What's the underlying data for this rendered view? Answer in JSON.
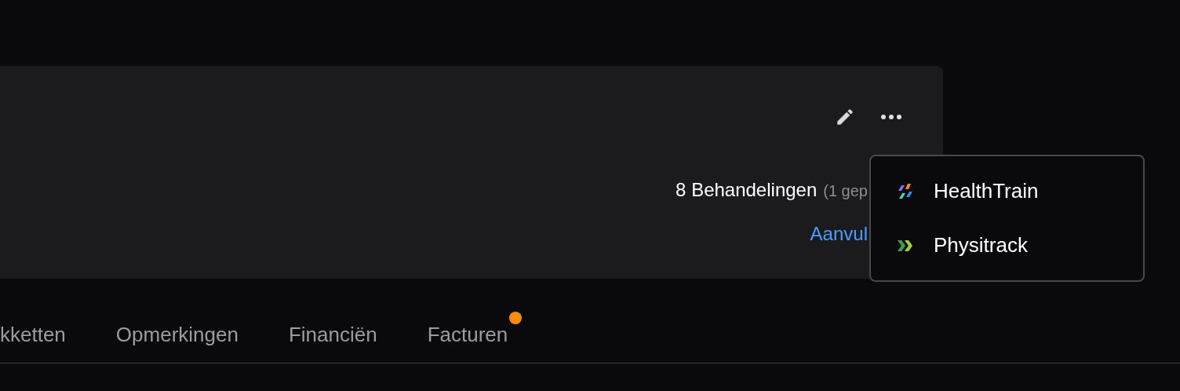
{
  "card": {
    "summary": "8 Behandelingen",
    "summary_note": "(1 gep",
    "link": "Aanvul"
  },
  "menu": {
    "items": [
      {
        "label": "HealthTrain",
        "kind": "healthtrain"
      },
      {
        "label": "Physitrack",
        "kind": "physitrack"
      }
    ]
  },
  "tabs": [
    {
      "label": "kketten",
      "badge": false
    },
    {
      "label": "Opmerkingen",
      "badge": false
    },
    {
      "label": "Financiën",
      "badge": false
    },
    {
      "label": "Facturen",
      "badge": true
    }
  ]
}
